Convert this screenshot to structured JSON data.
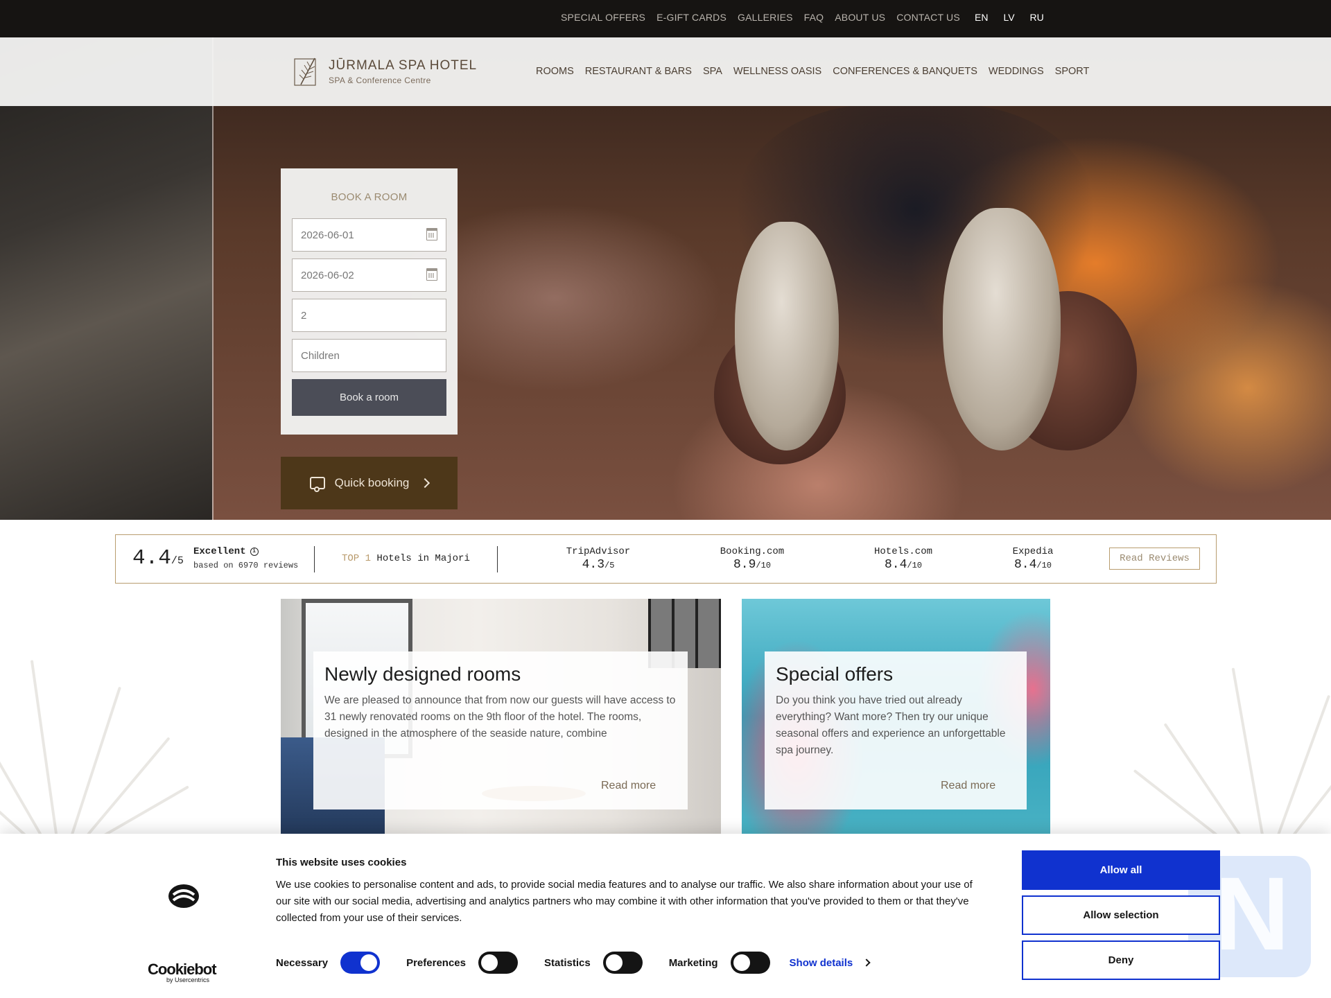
{
  "topbar": {
    "links": [
      "SPECIAL OFFERS",
      "E-GIFT CARDS",
      "GALLERIES",
      "FAQ",
      "ABOUT US",
      "CONTACT US"
    ],
    "languages": [
      "EN",
      "LV",
      "RU"
    ]
  },
  "logo": {
    "title": "JŪRMALA SPA HOTEL",
    "subtitle": "SPA & Conference Centre"
  },
  "nav": [
    "ROOMS",
    "RESTAURANT & BARS",
    "SPA",
    "WELLNESS OASIS",
    "CONFERENCES & BANQUETS",
    "WEDDINGS",
    "SPORT"
  ],
  "booking": {
    "title": "BOOK A ROOM",
    "checkin": "2026-06-01",
    "checkout": "2026-06-02",
    "adults": "2",
    "children_placeholder": "Children",
    "button": "Book a room",
    "quick": "Quick booking"
  },
  "reviews": {
    "score": "4.4",
    "score_max": "/5",
    "rating_label": "Excellent",
    "based_on": "based on 6970 reviews",
    "top_label": "TOP 1",
    "top_text": "Hotels in Majori",
    "sites": [
      {
        "name": "TripAdvisor",
        "score": "4.3",
        "max": "/5"
      },
      {
        "name": "Booking.com",
        "score": "8.9",
        "max": "/10"
      },
      {
        "name": "Hotels.com",
        "score": "8.4",
        "max": "/10"
      },
      {
        "name": "Expedia",
        "score": "8.4",
        "max": "/10"
      }
    ],
    "read_button": "Read Reviews"
  },
  "cards": [
    {
      "title": "Newly designed rooms",
      "text": "We are pleased to announce that from now our guests will have access to 31 newly renovated rooms on the 9th floor of the hotel. The rooms, designed in the atmosphere of the seaside nature, combine",
      "more": "Read more"
    },
    {
      "title": "Special offers",
      "text": "Do you think you have tried out already everything? Want more? Then try our unique seasonal offers and experience an unforgettable spa journey.",
      "more": "Read more"
    }
  ],
  "cookie": {
    "title": "This website uses cookies",
    "text": "We use cookies to personalise content and ads, to provide social media features and to analyse our traffic. We also share information about your use of our site with our social media, advertising and analytics partners who may combine it with other information that you've provided to them or that they've collected from your use of their services.",
    "brand": "Cookiebot",
    "brand_sub": "by Usercentrics",
    "toggles": [
      {
        "label": "Necessary",
        "on": true
      },
      {
        "label": "Preferences",
        "on": false
      },
      {
        "label": "Statistics",
        "on": false
      },
      {
        "label": "Marketing",
        "on": false
      }
    ],
    "show_details": "Show details",
    "allow_all": "Allow all",
    "allow_selection": "Allow selection",
    "deny": "Deny"
  },
  "colors": {
    "accent_blue": "#1032cf",
    "brand_brown": "#4d3719",
    "gold": "#b89c6e"
  }
}
